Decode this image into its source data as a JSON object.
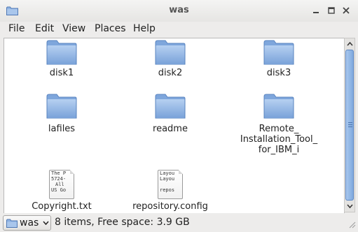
{
  "window": {
    "title": "was"
  },
  "menubar": {
    "items": [
      "File",
      "Edit",
      "View",
      "Places",
      "Help"
    ]
  },
  "files": {
    "disk1": "disk1",
    "disk2": "disk2",
    "disk3": "disk3",
    "lafiles": "lafiles",
    "readme": "readme",
    "remote_line1": "Remote_",
    "remote_line2": "Installation_Tool_",
    "remote_line3": "for_IBM_i",
    "copyright": "Copyright.txt",
    "copyright_preview": [
      "The P",
      "5724-",
      "All",
      "US Go"
    ],
    "repository": "repository.config",
    "repository_preview": [
      "Layou",
      "Layou",
      "",
      "repos"
    ]
  },
  "statusbar": {
    "location": "was",
    "summary": "8 items, Free space: 3.9 GB"
  },
  "colors": {
    "folder_light": "#a9c6ec",
    "folder_dark": "#6f9bd5",
    "scroll_thumb": "#7fa9de"
  },
  "icons": {
    "title": "folder-icon",
    "folder": "folder-icon",
    "document": "text-file-icon",
    "minimize": "minimize-icon",
    "maximize": "maximize-icon",
    "close": "close-icon"
  }
}
